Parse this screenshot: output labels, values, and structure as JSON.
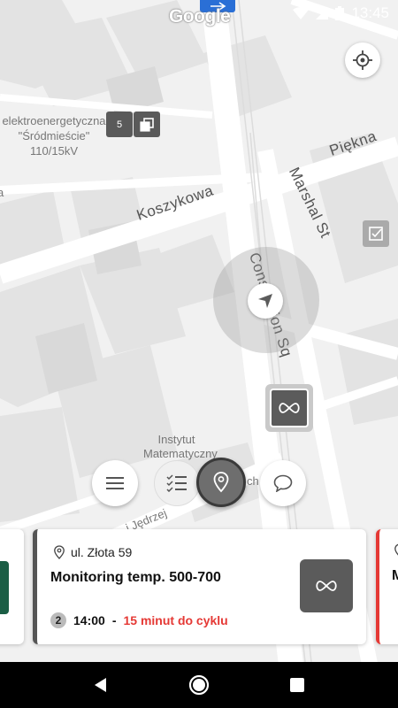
{
  "statusbar": {
    "time": "13:45"
  },
  "map": {
    "provider_logo": "Google",
    "labels": {
      "power_station_line1": "elektroenergetyczna",
      "power_station_line2": "\"Śródmieście\"",
      "power_station_line3": "110/15kV",
      "institute_line1": "Instytut",
      "institute_line2": "Matematyczny",
      "street_koszykowa": "Koszykowa",
      "street_piekna": "Piękna",
      "street_marshal": "Marshal St",
      "square_constitution": "Constitution Sq",
      "street_jedrzej": "i Jędrzej",
      "fragment_ch": "ch",
      "fragment_a": "a"
    },
    "cluster_count": "5"
  },
  "bottom_actions": {
    "menu_icon": "menu-icon",
    "list_icon": "checklist-icon",
    "map_icon": "map-pin-icon",
    "chat_icon": "chat-bubble-icon"
  },
  "cards": {
    "main": {
      "address": "ul. Złota 59",
      "title": "Monitoring temp. 500-700",
      "count": "2",
      "time": "14:00",
      "separator": "-",
      "cycle_note": "15 minut do cyklu",
      "type_icon": "infinity-icon"
    },
    "right_peek_letter": "M"
  },
  "colors": {
    "accent_red": "#e53935",
    "accent_green": "#1b5e45",
    "marker_gray": "#5b5b5b"
  }
}
